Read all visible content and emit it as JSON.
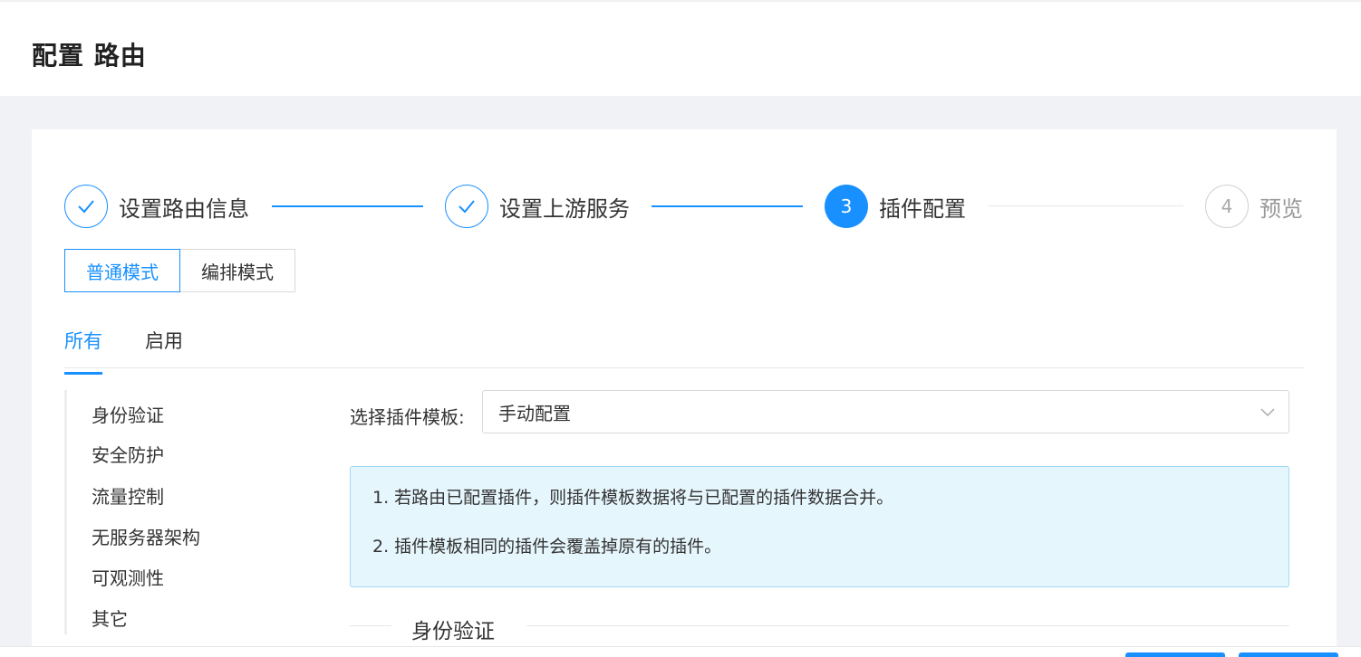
{
  "page": {
    "title": "配置 路由"
  },
  "steps": [
    {
      "label": "设置路由信息",
      "status": "done",
      "number": ""
    },
    {
      "label": "设置上游服务",
      "status": "done",
      "number": ""
    },
    {
      "label": "插件配置",
      "status": "active",
      "number": "3"
    },
    {
      "label": "预览",
      "status": "wait",
      "number": "4"
    }
  ],
  "mode_switch": {
    "normal": "普通模式",
    "orchestration": "编排模式",
    "selected": "普通模式"
  },
  "tabs": [
    {
      "label": "所有",
      "active": true
    },
    {
      "label": "启用",
      "active": false
    }
  ],
  "side_menu": [
    {
      "label": "身份验证"
    },
    {
      "label": "安全防护"
    },
    {
      "label": "流量控制"
    },
    {
      "label": "无服务器架构"
    },
    {
      "label": "可观测性"
    },
    {
      "label": "其它"
    }
  ],
  "template_select": {
    "label": "选择插件模板:",
    "value": "手动配置"
  },
  "alert": {
    "line1": "1. 若路由已配置插件，则插件模板数据将与已配置的插件数据合并。",
    "line2": "2. 插件模板相同的插件会覆盖掉原有的插件。"
  },
  "section": {
    "title": "身份验证"
  },
  "colors": {
    "primary": "#1890ff",
    "alert_bg": "#e6f6fd",
    "page_bg": "#f0f2f5"
  }
}
